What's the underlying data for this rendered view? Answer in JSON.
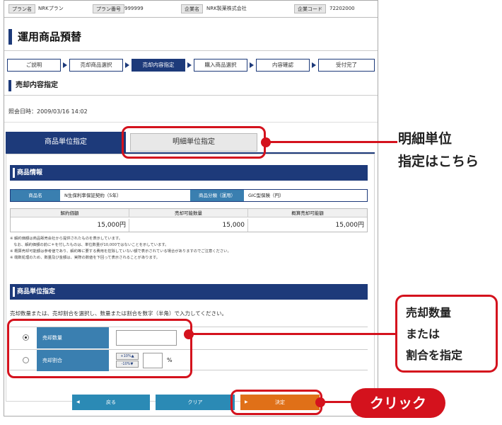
{
  "infobar": {
    "plan_name_label": "プラン名",
    "plan_name_value": "NRKプラン",
    "plan_no_label": "プラン番号",
    "plan_no_value": "999999",
    "company_label": "企業名",
    "company_value": "NRK製薬株式会社",
    "company_code_label": "企業コード",
    "company_code_value": "72202000"
  },
  "page_title": "運用商品預替",
  "steps": [
    "ご説明",
    "売却商品選択",
    "売却内容指定",
    "購入商品選択",
    "内容確認",
    "受付完了"
  ],
  "active_step": 2,
  "section_title": "売却内容指定",
  "reference_time": "照会日時：2009/03/16 14:02",
  "tabs": {
    "product_unit": "商品単位指定",
    "detail_unit": "明細単位指定"
  },
  "product_info": {
    "header": "商品情報",
    "name_label": "商品名",
    "name_value": "N生保利率保証契約（5年）",
    "category_label": "商品分類（運用）",
    "category_value": "GIC型保険（円）",
    "columns": [
      "解約価額",
      "売却可能数量",
      "概算売却可能額"
    ],
    "values": [
      "15,000円",
      "15,000",
      "15,000円"
    ]
  },
  "notes": [
    "※ 解約価額は商品販売会社から提供されたものを表示しています。",
    "　なお、解約価額の前に＊を付したものは、単位数量が10,000ではないことを示しています。",
    "※ 概算売却可能額は参考値であり、解約等に要する費用を控除していない額で表示されている場合がありますのでご注意ください。",
    "※ 端数処理のため、数量及び金額は、実際の数値を下回って表示されることがあります。"
  ],
  "unit_spec": {
    "header": "商品単位指定",
    "instruction": "売却数量または、売却割合を選択し、数量または割合を数字（半角）で入力してください。",
    "qty_label": "売却数量",
    "qty_value": "",
    "ratio_label": "売却割合",
    "ratio_up": "+10%▲",
    "ratio_down": "-10%▼",
    "ratio_value": "",
    "ratio_unit": "%"
  },
  "buttons": {
    "back": "戻る",
    "clear": "クリア",
    "ok": "決定"
  },
  "annotations": {
    "detail_line1": "明細単位",
    "detail_line2": "指定はこちら",
    "qty_line1": "売却数量",
    "qty_line2": "または",
    "qty_line3": "割合を指定",
    "click": "クリック"
  },
  "colors": {
    "navy": "#1d3a7a",
    "label_blue": "#3a7fb0",
    "highlight_red": "#d4121d",
    "decide_orange": "#e07018"
  }
}
